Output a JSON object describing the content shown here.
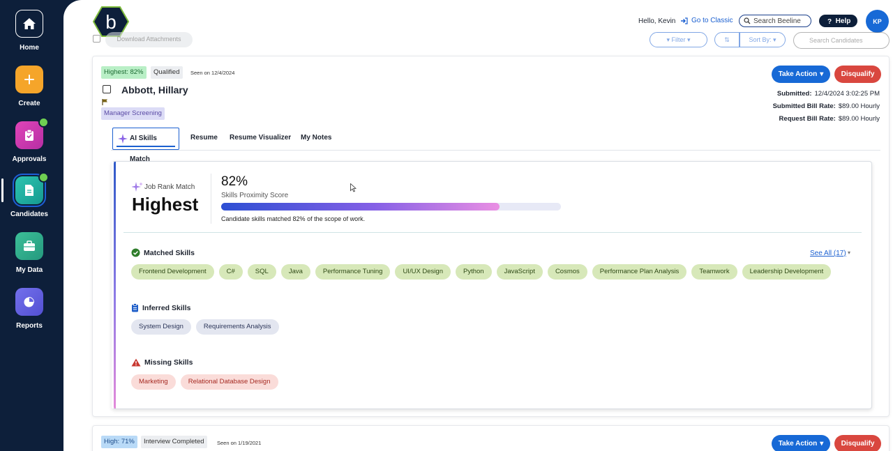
{
  "nav": {
    "items": [
      {
        "label": "Home",
        "icon": "home-icon"
      },
      {
        "label": "Create",
        "icon": "plus-icon"
      },
      {
        "label": "Approvals",
        "icon": "clipboard-check-icon"
      },
      {
        "label": "Candidates",
        "icon": "document-icon"
      },
      {
        "label": "My Data",
        "icon": "briefcase-icon"
      },
      {
        "label": "Reports",
        "icon": "pie-chart-icon"
      }
    ],
    "active": "Candidates"
  },
  "header": {
    "logo_letter": "b",
    "greeting": "Hello, Kevin",
    "classic_link": "Go to Classic",
    "search_placeholder": "Search Beeline",
    "help_label": "Help",
    "avatar_initials": "KP"
  },
  "toolbar": {
    "download_label": "Download Attachments",
    "filter_label": "Filter",
    "sort_label": "Sort By:",
    "search_placeholder": "Search Candidates"
  },
  "candidate": {
    "rank_badge": "Highest: 82%",
    "status_badge": "Qualified",
    "seen": "Seen on 12/4/2024",
    "name": "Abbott, Hillary",
    "stage_badge": "Manager Screening",
    "take_action": "Take Action",
    "disqualify": "Disqualify",
    "submitted_label": "Submitted:",
    "submitted_value": "12/4/2024 3:02:25 PM",
    "bill_rate_label": "Submitted Bill Rate:",
    "bill_rate_value": "$89.00 Hourly",
    "request_rate_label": "Request Bill Rate:",
    "request_rate_value": "$89.00 Hourly",
    "tabs": [
      "AI Skills Match",
      "Resume",
      "Resume Visualizer",
      "My Notes"
    ],
    "active_tab": "AI Skills Match"
  },
  "match": {
    "job_rank_label": "Job Rank Match",
    "rank": "Highest",
    "score": "82%",
    "score_fraction": 0.82,
    "score_label": "Skills Proximity Score",
    "score_desc": "Candidate skills matched 82% of the scope of work.",
    "matched_title": "Matched Skills",
    "see_all": "See All (17)",
    "matched": [
      "Frontend Development",
      "C#",
      "SQL",
      "Java",
      "Performance Tuning",
      "UI/UX Design",
      "Python",
      "JavaScript",
      "Cosmos",
      "Performance Plan Analysis",
      "Teamwork",
      "Leadership Development"
    ],
    "inferred_title": "Inferred Skills",
    "inferred": [
      "System Design",
      "Requirements Analysis"
    ],
    "missing_title": "Missing Skills",
    "missing": [
      "Marketing",
      "Relational Database Design"
    ]
  },
  "candidate2": {
    "rank_badge": "High: 71%",
    "status_badge": "Interview Completed",
    "seen": "Seen on 1/19/2021",
    "take_action": "Take Action",
    "disqualify": "Disqualify"
  },
  "colors": {
    "nav_bg": "#0d1f3a",
    "create_tile": "#f5a52a",
    "approvals_tile": "#d63ab0",
    "candidates_tile": "#1fb3a3",
    "mydata_tile": "#2fae8f",
    "reports_tile": "#6360e0",
    "primary": "#1769d6",
    "danger": "#d9473f"
  }
}
